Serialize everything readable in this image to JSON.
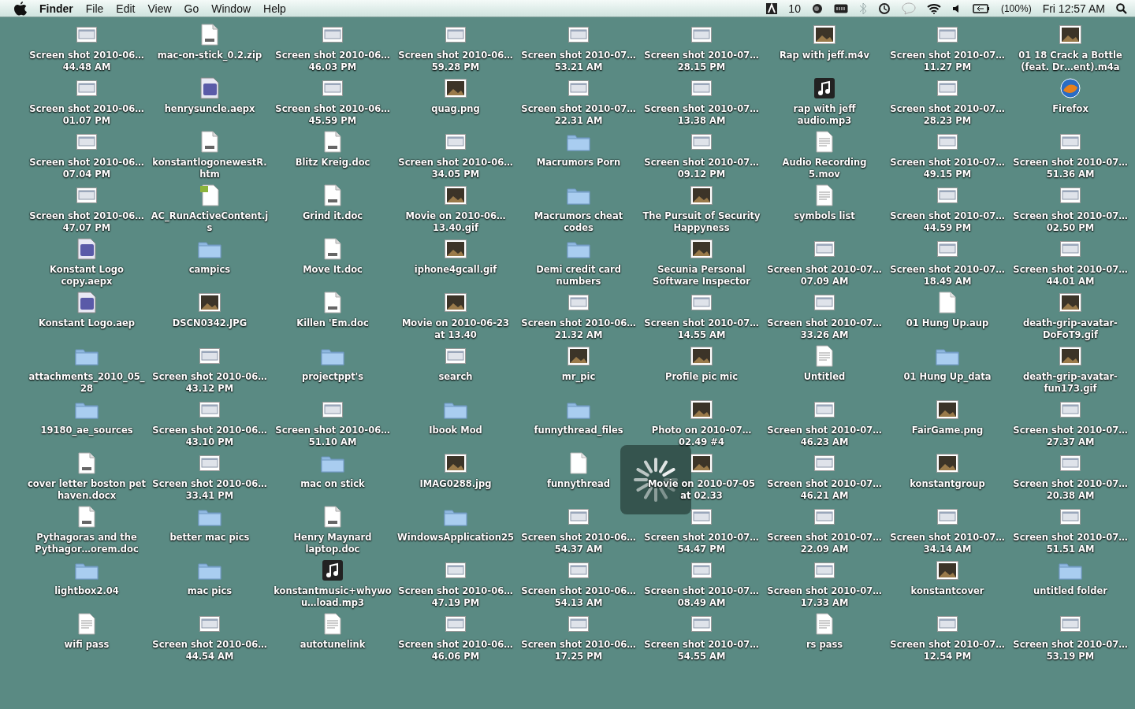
{
  "menubar": {
    "app": "Finder",
    "menus": [
      "File",
      "Edit",
      "View",
      "Go",
      "Window",
      "Help"
    ],
    "status": {
      "adobe_count": "10",
      "battery": "(100%)",
      "clock": "Fri 12:57 AM"
    }
  },
  "desktop_items": [
    {
      "name": "Screen shot 2010-06…44.48 AM",
      "kind": "screenshot"
    },
    {
      "name": "Screen shot 2010-06…01.07 PM",
      "kind": "screenshot"
    },
    {
      "name": "Screen shot 2010-06…07.04 PM",
      "kind": "screenshot"
    },
    {
      "name": "Screen shot 2010-06…47.07 PM",
      "kind": "screenshot"
    },
    {
      "name": "Konstant Logo copy.aepx",
      "kind": "aftereffects"
    },
    {
      "name": "Konstant Logo.aep",
      "kind": "aftereffects"
    },
    {
      "name": "attachments_2010_05_28",
      "kind": "folder"
    },
    {
      "name": "19180_ae_sources",
      "kind": "folder"
    },
    {
      "name": "cover letter boston pet haven.docx",
      "kind": "document"
    },
    {
      "name": "Pythagoras and the Pythagor…orem.doc",
      "kind": "document"
    },
    {
      "name": "lightbox2.04",
      "kind": "folder"
    },
    {
      "name": "wifi pass",
      "kind": "text"
    },
    {
      "name": "mac-on-stick_0.2.zip",
      "kind": "document"
    },
    {
      "name": "henrysuncle.aepx",
      "kind": "aftereffects"
    },
    {
      "name": "konstantlogonewestR.htm",
      "kind": "document"
    },
    {
      "name": "AC_RunActiveContent.js",
      "kind": "script"
    },
    {
      "name": "campics",
      "kind": "folder"
    },
    {
      "name": "DSCN0342.JPG",
      "kind": "image"
    },
    {
      "name": "Screen shot 2010-06…43.12 PM",
      "kind": "screenshot"
    },
    {
      "name": "Screen shot 2010-06…43.10 PM",
      "kind": "screenshot"
    },
    {
      "name": "Screen shot 2010-06…33.41 PM",
      "kind": "screenshot"
    },
    {
      "name": "better mac pics",
      "kind": "folder"
    },
    {
      "name": "mac pics",
      "kind": "folder"
    },
    {
      "name": "Screen shot 2010-06…44.54 AM",
      "kind": "screenshot"
    },
    {
      "name": "Screen shot 2010-06…46.03 PM",
      "kind": "screenshot"
    },
    {
      "name": "Screen shot 2010-06…45.59 PM",
      "kind": "screenshot"
    },
    {
      "name": "Blitz Kreig.doc",
      "kind": "document"
    },
    {
      "name": "Grind it.doc",
      "kind": "document"
    },
    {
      "name": "Move It.doc",
      "kind": "document"
    },
    {
      "name": "Killen 'Em.doc",
      "kind": "document"
    },
    {
      "name": "projectppt's",
      "kind": "folder"
    },
    {
      "name": "Screen shot 2010-06…51.10 AM",
      "kind": "screenshot"
    },
    {
      "name": "mac on stick",
      "kind": "folder"
    },
    {
      "name": "Henry Maynard laptop.doc",
      "kind": "document"
    },
    {
      "name": "konstantmusic+whywou…load.mp3",
      "kind": "audio"
    },
    {
      "name": "autotunelink",
      "kind": "text"
    },
    {
      "name": "Screen shot 2010-06…59.28 PM",
      "kind": "screenshot"
    },
    {
      "name": "quag.png",
      "kind": "image"
    },
    {
      "name": "Screen shot 2010-06…34.05 PM",
      "kind": "screenshot"
    },
    {
      "name": "Movie on 2010-06… 13.40.gif",
      "kind": "image"
    },
    {
      "name": "iphone4gcall.gif",
      "kind": "image"
    },
    {
      "name": "Movie on 2010-06-23 at 13.40",
      "kind": "image"
    },
    {
      "name": "search",
      "kind": "screenshot"
    },
    {
      "name": "Ibook Mod",
      "kind": "folder"
    },
    {
      "name": "IMAG0288.jpg",
      "kind": "image"
    },
    {
      "name": "WindowsApplication25",
      "kind": "folder"
    },
    {
      "name": "Screen shot 2010-06…47.19 PM",
      "kind": "screenshot"
    },
    {
      "name": "Screen shot 2010-06…46.06 PM",
      "kind": "screenshot"
    },
    {
      "name": "Screen shot 2010-07…53.21 AM",
      "kind": "screenshot"
    },
    {
      "name": "Screen shot 2010-07…22.31 AM",
      "kind": "screenshot"
    },
    {
      "name": "Macrumors Porn",
      "kind": "folder"
    },
    {
      "name": "Macrumors cheat codes",
      "kind": "folder"
    },
    {
      "name": "Demi credit card numbers",
      "kind": "folder"
    },
    {
      "name": "Screen shot 2010-06…21.32 AM",
      "kind": "screenshot"
    },
    {
      "name": "mr_pic",
      "kind": "image"
    },
    {
      "name": "funnythread_files",
      "kind": "folder"
    },
    {
      "name": "funnythread",
      "kind": "blank"
    },
    {
      "name": "Screen shot 2010-06…54.37 AM",
      "kind": "screenshot"
    },
    {
      "name": "Screen shot 2010-06…54.13 AM",
      "kind": "screenshot"
    },
    {
      "name": "Screen shot 2010-06…17.25 PM",
      "kind": "screenshot"
    },
    {
      "name": "Screen shot 2010-07…28.15 PM",
      "kind": "screenshot"
    },
    {
      "name": "Screen shot 2010-07…13.38 AM",
      "kind": "screenshot"
    },
    {
      "name": "Screen shot 2010-07…09.12 PM",
      "kind": "screenshot"
    },
    {
      "name": "The Pursuit of Security Happyness",
      "kind": "image"
    },
    {
      "name": "Secunia Personal Software Inspector",
      "kind": "image"
    },
    {
      "name": "Screen shot 2010-07…14.55 AM",
      "kind": "screenshot"
    },
    {
      "name": "Profile pic mic",
      "kind": "image"
    },
    {
      "name": "Photo on 2010-07… 02.49 #4",
      "kind": "image"
    },
    {
      "name": "Movie on 2010-07-05 at 02.33",
      "kind": "image"
    },
    {
      "name": "Screen shot 2010-07…54.47 PM",
      "kind": "screenshot"
    },
    {
      "name": "Screen shot 2010-07…08.49 AM",
      "kind": "screenshot"
    },
    {
      "name": "Screen shot 2010-07…54.55 AM",
      "kind": "screenshot"
    },
    {
      "name": "Rap with jeff.m4v",
      "kind": "image"
    },
    {
      "name": "rap with jeff audio.mp3",
      "kind": "audio"
    },
    {
      "name": "Audio Recording 5.mov",
      "kind": "text"
    },
    {
      "name": "symbols list",
      "kind": "text"
    },
    {
      "name": "Screen shot 2010-07…07.09 AM",
      "kind": "screenshot"
    },
    {
      "name": "Screen shot 2010-07…33.26 AM",
      "kind": "screenshot"
    },
    {
      "name": "Untitled",
      "kind": "text"
    },
    {
      "name": "Screen shot 2010-07…46.23 AM",
      "kind": "screenshot"
    },
    {
      "name": "Screen shot 2010-07…46.21 AM",
      "kind": "screenshot"
    },
    {
      "name": "Screen shot 2010-07…22.09 AM",
      "kind": "screenshot"
    },
    {
      "name": "Screen shot 2010-07…17.33 AM",
      "kind": "screenshot"
    },
    {
      "name": "rs pass",
      "kind": "text"
    },
    {
      "name": "Screen shot 2010-07…11.27 PM",
      "kind": "screenshot"
    },
    {
      "name": "Screen shot 2010-07…28.23 PM",
      "kind": "screenshot"
    },
    {
      "name": "Screen shot 2010-07…49.15 PM",
      "kind": "screenshot"
    },
    {
      "name": "Screen shot 2010-07…44.59 PM",
      "kind": "screenshot"
    },
    {
      "name": "Screen shot 2010-07…18.49 AM",
      "kind": "screenshot"
    },
    {
      "name": "01 Hung Up.aup",
      "kind": "blank"
    },
    {
      "name": "01 Hung Up_data",
      "kind": "folder"
    },
    {
      "name": "FairGame.png",
      "kind": "image"
    },
    {
      "name": "konstantgroup",
      "kind": "image"
    },
    {
      "name": "Screen shot 2010-07…34.14 AM",
      "kind": "screenshot"
    },
    {
      "name": "konstantcover",
      "kind": "image"
    },
    {
      "name": "Screen shot 2010-07…12.54 PM",
      "kind": "screenshot"
    },
    {
      "name": "01 18 Crack a Bottle (feat. Dr…ent).m4a",
      "kind": "image"
    },
    {
      "name": "Firefox",
      "kind": "app"
    },
    {
      "name": "Screen shot 2010-07…51.36 AM",
      "kind": "screenshot"
    },
    {
      "name": "Screen shot 2010-07…02.50 PM",
      "kind": "screenshot"
    },
    {
      "name": "Screen shot 2010-07…44.01 AM",
      "kind": "screenshot"
    },
    {
      "name": "death-grip-avatar-DoFoT9.gif",
      "kind": "image"
    },
    {
      "name": "death-grip-avatar-fun173.gif",
      "kind": "image"
    },
    {
      "name": "Screen shot 2010-07…27.37 AM",
      "kind": "screenshot"
    },
    {
      "name": "Screen shot 2010-07…20.38 AM",
      "kind": "screenshot"
    },
    {
      "name": "Screen shot 2010-07…51.51 AM",
      "kind": "screenshot"
    },
    {
      "name": "untitled folder",
      "kind": "folder"
    },
    {
      "name": "Screen shot 2010-07…53.19 PM",
      "kind": "screenshot"
    }
  ]
}
